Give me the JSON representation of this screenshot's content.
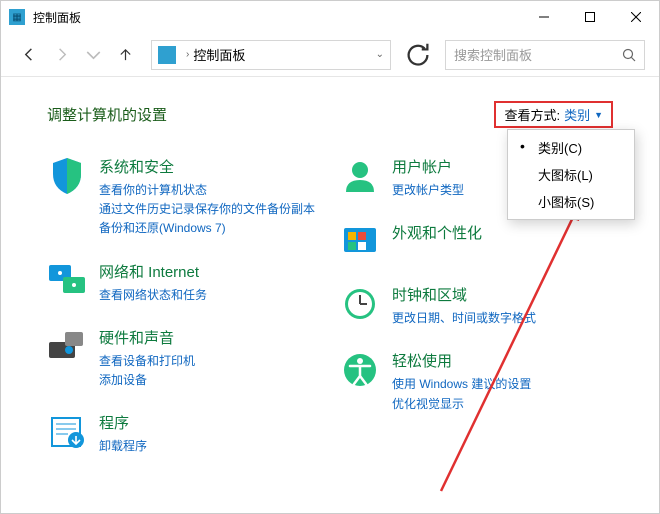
{
  "window": {
    "title": "控制面板"
  },
  "path": {
    "text": "控制面板"
  },
  "search": {
    "placeholder": "搜索控制面板"
  },
  "adjust": "调整计算机的设置",
  "viewby": {
    "label": "查看方式:",
    "value": "类别"
  },
  "menu": {
    "items": [
      {
        "label": "类别(C)",
        "selected": true
      },
      {
        "label": "大图标(L)",
        "selected": false
      },
      {
        "label": "小图标(S)",
        "selected": false
      }
    ]
  },
  "left": [
    {
      "title": "系统和安全",
      "links": [
        "查看你的计算机状态",
        "通过文件历史记录保存你的文件备份副本",
        "备份和还原(Windows 7)"
      ]
    },
    {
      "title": "网络和 Internet",
      "links": [
        "查看网络状态和任务"
      ]
    },
    {
      "title": "硬件和声音",
      "links": [
        "查看设备和打印机",
        "添加设备"
      ]
    },
    {
      "title": "程序",
      "links": [
        "卸载程序"
      ]
    }
  ],
  "right": [
    {
      "title": "用户帐户",
      "links": [
        "更改帐户类型"
      ]
    },
    {
      "title": "外观和个性化",
      "links": []
    },
    {
      "title": "时钟和区域",
      "links": [
        "更改日期、时间或数字格式"
      ]
    },
    {
      "title": "轻松使用",
      "links": [
        "使用 Windows 建议的设置",
        "优化视觉显示"
      ]
    }
  ]
}
